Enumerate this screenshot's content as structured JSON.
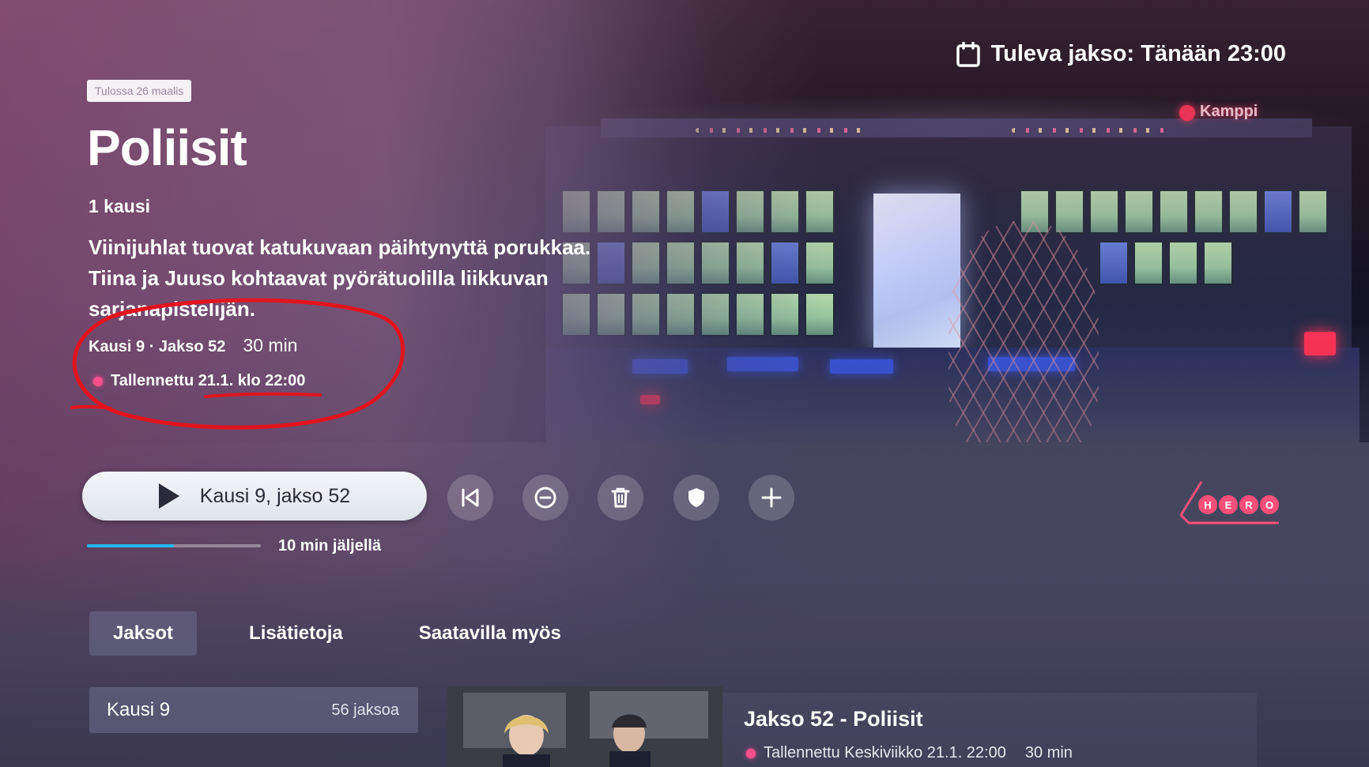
{
  "header": {
    "upcoming_label": "Tuleva jakso: Tänään 23:00",
    "calendar_icon": "calendar-icon"
  },
  "show": {
    "badge": "Tulossa 26 maalis",
    "title": "Poliisit",
    "seasons": "1 kausi",
    "description": "Viinijuhlat tuovat katukuvaan päihtynyttä porukkaa. Tiina ja Juuso kohtaavat pyörätuolilla liikkuvan sarjanapistelijän.",
    "episode_meta": "Kausi 9 · Jakso 52",
    "duration": "30 min",
    "recorded": "Tallennettu 21.1. klo 22:00"
  },
  "actions": {
    "play_label": "Kausi 9, jakso 52",
    "icons": [
      "restart-icon",
      "remove-icon",
      "delete-icon",
      "protect-icon",
      "add-icon"
    ]
  },
  "progress": {
    "fraction": 0.5,
    "remaining": "10 min jäljellä"
  },
  "channel": {
    "logo_text": "HERO"
  },
  "tabs": [
    {
      "label": "Jaksot",
      "active": true
    },
    {
      "label": "Lisätietoja",
      "active": false
    },
    {
      "label": "Saatavilla myös",
      "active": false
    }
  ],
  "season_selector": {
    "name": "Kausi 9",
    "count": "56 jaksoa"
  },
  "episode": {
    "title": "Jakso 52 - Poliisit",
    "recorded": "Tallennettu Keskiviikko 21.1. 22:00",
    "duration": "30 min"
  },
  "colors": {
    "progress": "#22b8f0",
    "recorded_dot": "#ff4f8f",
    "annotation": "#e3141e"
  }
}
